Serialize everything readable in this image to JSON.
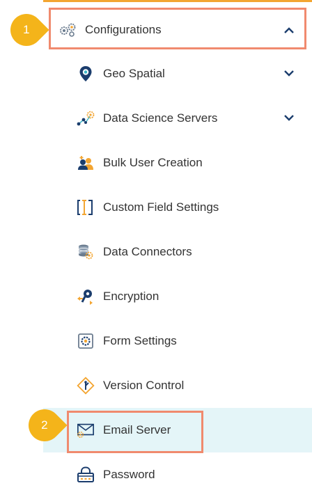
{
  "badges": [
    "1",
    "2"
  ],
  "menu": {
    "header": {
      "label": "Configurations",
      "icon": "gears-icon",
      "expanded": true
    },
    "items": [
      {
        "label": "Geo Spatial",
        "icon": "map-pin-icon",
        "has_dropdown": true
      },
      {
        "label": "Data Science Servers",
        "icon": "data-science-icon",
        "has_dropdown": true
      },
      {
        "label": "Bulk User Creation",
        "icon": "users-add-icon"
      },
      {
        "label": "Custom Field Settings",
        "icon": "text-cursor-icon"
      },
      {
        "label": "Data Connectors",
        "icon": "database-gear-icon"
      },
      {
        "label": "Encryption",
        "icon": "key-icon"
      },
      {
        "label": "Form Settings",
        "icon": "form-gear-icon"
      },
      {
        "label": "Version Control",
        "icon": "branch-icon"
      },
      {
        "label": "Email Server",
        "icon": "mail-icon",
        "active": true
      },
      {
        "label": "Password",
        "icon": "lock-icon"
      }
    ]
  },
  "colors": {
    "accent_orange": "#f3a531",
    "highlight_border": "#f08a6e",
    "badge": "#f4b41a",
    "active_bg": "#e4f5f8",
    "icon_blue": "#1b3d6d"
  }
}
